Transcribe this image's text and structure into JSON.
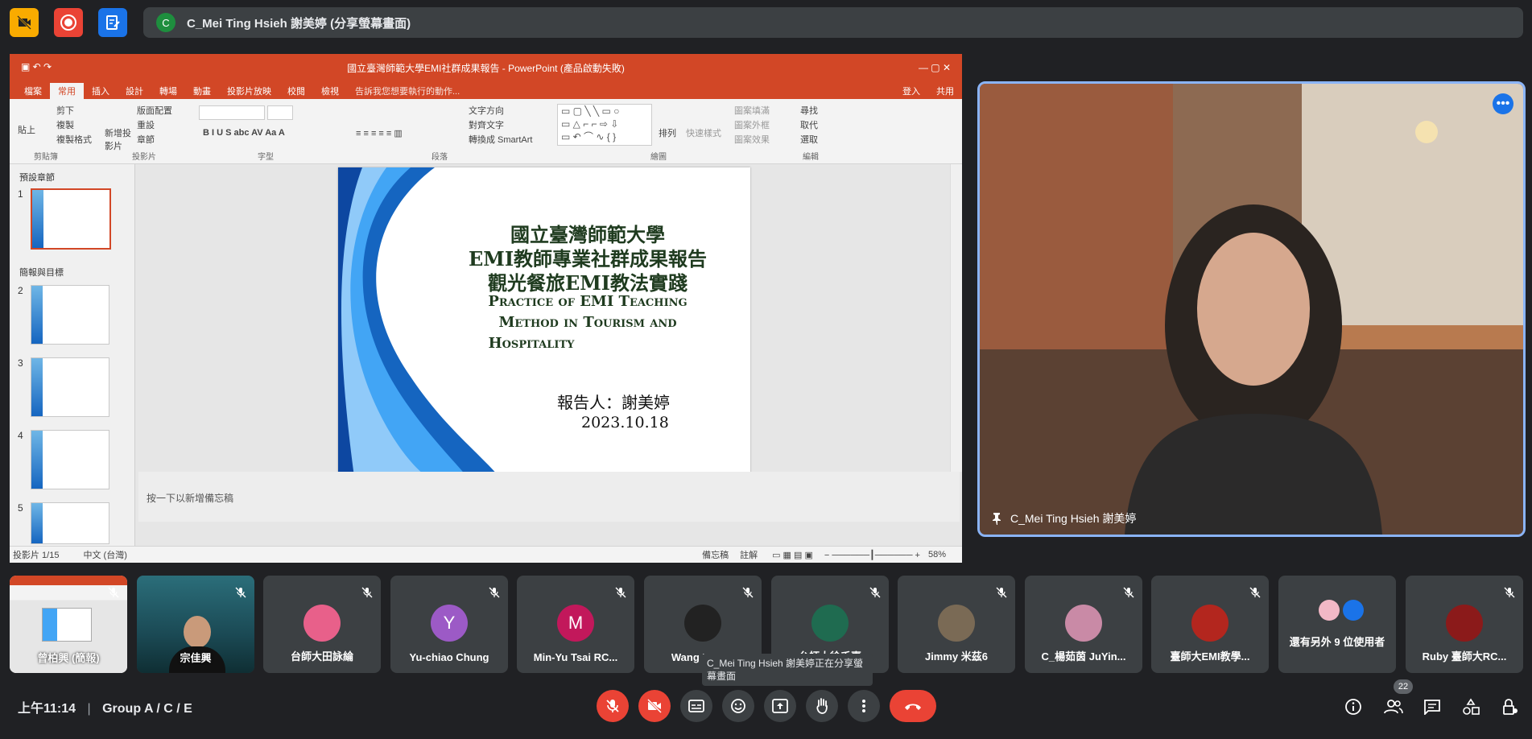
{
  "presenter_bar": {
    "avatar_letter": "C",
    "text": "C_Mei Ting Hsieh 謝美婷 (分享螢幕畫面)"
  },
  "powerpoint": {
    "window_title": "國立臺灣師範大學EMI社群成果報告 - PowerPoint (產品啟動失敗)",
    "tabs": [
      "檔案",
      "常用",
      "插入",
      "設計",
      "轉場",
      "動畫",
      "投影片放映",
      "校閱",
      "檢視"
    ],
    "active_tab": "常用",
    "search_hint": "告訴我您想要執行的動作...",
    "signin": "登入",
    "share": "共用",
    "ribbon_groups": [
      "剪貼簿",
      "投影片",
      "字型",
      "段落",
      "繪圖",
      "編輯"
    ],
    "ribbon_items": {
      "paste": "貼上",
      "cut": "剪下",
      "copy": "複製",
      "format_painter": "複製格式",
      "new_slide": "新增投影片",
      "layout": "版面配置",
      "reset": "重設",
      "section": "章節",
      "find": "尋找",
      "replace": "取代",
      "select": "選取",
      "arrange": "排列",
      "quick_styles": "快速樣式",
      "shape_fill": "圖案填滿",
      "shape_outline": "圖案外框",
      "shape_effects": "圖案效果",
      "text_direction": "文字方向",
      "align_text": "對齊文字",
      "smartart": "轉換成 SmartArt"
    },
    "sections": [
      "預設章節",
      "簡報與目標"
    ],
    "thumbnail_numbers": [
      "1",
      "2",
      "3",
      "4",
      "5"
    ],
    "slide": {
      "title_lines": [
        "國立臺灣師範大學",
        "EMI教師專業社群成果報告",
        "觀光餐旅EMI教法實踐"
      ],
      "english_lines": [
        "Practice of EMI Teaching",
        "Method in Tourism and",
        "Hospitality"
      ],
      "presenter": "報告人：謝美婷",
      "date": "2023.10.18"
    },
    "notes_placeholder": "按一下以新增備忘稿",
    "status": {
      "slide_count": "投影片 1/15",
      "language": "中文 (台灣)",
      "notes": "備忘稿",
      "comments": "註解",
      "zoom": "58%"
    }
  },
  "speaker": {
    "name": "C_Mei Ting Hsieh 謝美婷"
  },
  "participants": [
    {
      "name": "曾柏興 (簡報)",
      "type": "screen"
    },
    {
      "name": "宗佳興",
      "type": "video"
    },
    {
      "name": "台師大田詠綸",
      "avatar": "",
      "color": "#e8608a"
    },
    {
      "name": "Yu-chiao Chung",
      "avatar": "Y",
      "color": "#9c5ac6"
    },
    {
      "name": "Min-Yu Tsai RC...",
      "avatar": "M",
      "color": "#c2185b"
    },
    {
      "name": "Wang Ke-L...",
      "avatar": "",
      "color": "#222"
    },
    {
      "name": "台師大徐千惠",
      "avatar": "",
      "color": "#1f6b50"
    },
    {
      "name": "Jimmy 米茲6",
      "avatar": "",
      "color": "#7a6a55"
    },
    {
      "name": "C_楊茹茵 JuYin...",
      "avatar": "",
      "color": "#c98aa6"
    },
    {
      "name": "臺師大EMI教學...",
      "avatar": "",
      "color": "#b3261e"
    },
    {
      "name": "還有另外 9 位使用者",
      "type": "more"
    },
    {
      "name": "Ruby 臺師大RC...",
      "avatar": "",
      "color": "#8b1a1a"
    }
  ],
  "tooltip": "C_Mei Ting Hsieh 謝美婷正在分享螢幕畫面",
  "bottom_bar": {
    "time": "上午11:14",
    "meeting": "Group A / C / E",
    "participant_count": "22"
  },
  "colors": {
    "bg": "#202124",
    "tile": "#3c4043",
    "accent": "#8ab4f8",
    "danger": "#ea4335",
    "ppt_red": "#d24726"
  }
}
